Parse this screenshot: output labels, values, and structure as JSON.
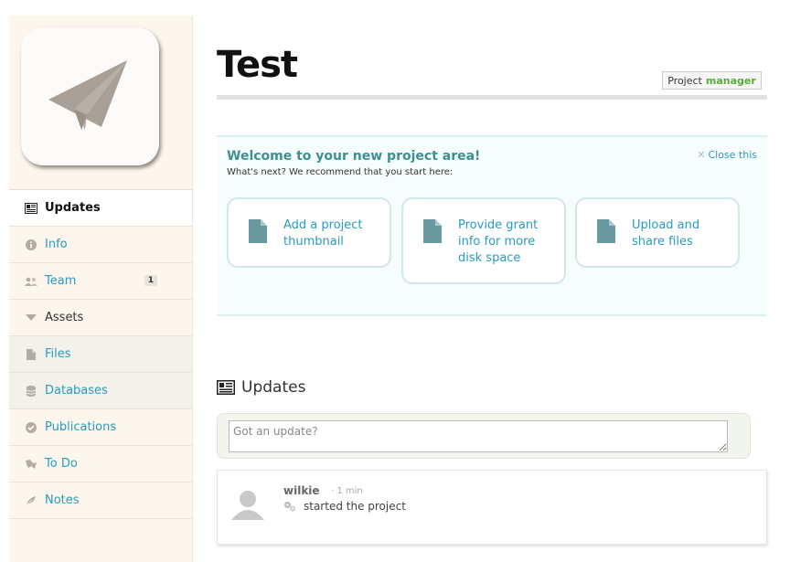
{
  "project": {
    "title": "Test",
    "role_prefix": "Project",
    "role": "manager",
    "logo_icon": "paper-plane-icon"
  },
  "sidebar": {
    "items": [
      {
        "label": "Updates",
        "icon": "newspaper-icon"
      },
      {
        "label": "Info",
        "icon": "info-icon"
      },
      {
        "label": "Team",
        "icon": "team-icon",
        "badge": "1"
      },
      {
        "label": "Assets",
        "icon": "triangle-down-icon"
      },
      {
        "label": "Files",
        "icon": "file-icon"
      },
      {
        "label": "Databases",
        "icon": "database-icon"
      },
      {
        "label": "Publications",
        "icon": "check-circle-icon"
      },
      {
        "label": "To Do",
        "icon": "todo-icon"
      },
      {
        "label": "Notes",
        "icon": "feather-icon"
      }
    ]
  },
  "welcome": {
    "heading": "Welcome to your new project area!",
    "subtext": "What's next? We recommend that you start here:",
    "close_label": "Close this",
    "cards": [
      {
        "line1": "Add a project",
        "line2": "thumbnail",
        "line3": ""
      },
      {
        "line1": "Provide grant",
        "line2": "info for more",
        "line3": "disk space"
      },
      {
        "line1": "Upload and",
        "line2": "share files",
        "line3": ""
      }
    ]
  },
  "updates": {
    "heading": "Updates",
    "composer_placeholder": "Got an update?",
    "entries": [
      {
        "user": "wilkie",
        "time": "· 1 min",
        "action": "started the project"
      }
    ]
  },
  "colors": {
    "accent_link": "#2a9ac2",
    "welcome_heading": "#3e8f8f",
    "role_green": "#5bab3a",
    "sidebar_bg": "#fdf6ec"
  }
}
